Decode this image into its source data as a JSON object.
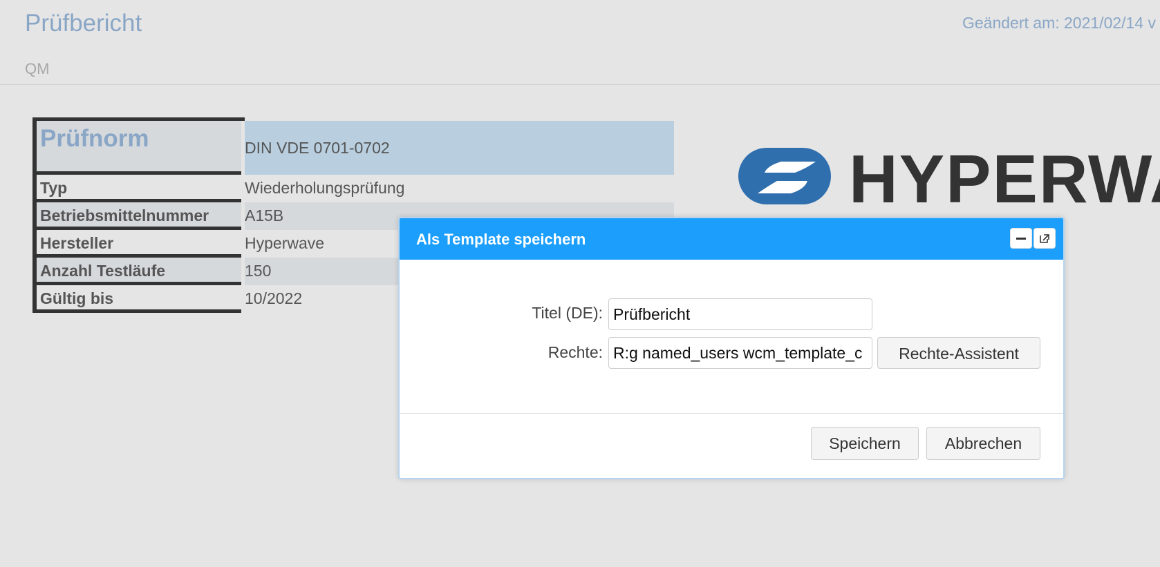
{
  "header": {
    "title": "Prüfbericht",
    "modified": "Geändert am: 2021/02/14 v",
    "category": "QM"
  },
  "logo": {
    "text": "HYPERWA"
  },
  "properties": {
    "norm_label": "Prüfnorm",
    "norm_value": "DIN VDE 0701-0702",
    "rows": [
      {
        "label": "Typ",
        "value": "Wiederholungsprüfung"
      },
      {
        "label": "Betriebsmittelnummer",
        "value": "A15B"
      },
      {
        "label": "Hersteller",
        "value": "Hyperwave"
      },
      {
        "label": "Anzahl Testläufe",
        "value": "150"
      },
      {
        "label": "Gültig bis",
        "value": "10/2022"
      }
    ]
  },
  "dialog": {
    "title": "Als Template speichern",
    "title_label": "Titel (DE):",
    "title_value": "Prüfbericht",
    "rights_label": "Rechte:",
    "rights_value": "R:g named_users wcm_template_c",
    "rights_button": "Rechte-Assistent",
    "save_button": "Speichern",
    "cancel_button": "Abbrechen"
  },
  "colors": {
    "accent": "#1b9efc",
    "title_blue": "#8aa6c6",
    "norm_row_bg": "#b9cfdf",
    "logo_blue": "#2f6fae",
    "logo_dark": "#333333"
  }
}
